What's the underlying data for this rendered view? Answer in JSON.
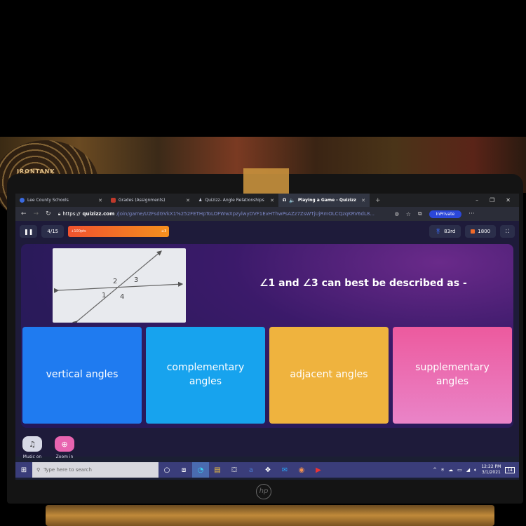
{
  "browser": {
    "tabs": [
      {
        "label": "Lee County Schools",
        "active": false,
        "favicon_color": "#3a6ae0"
      },
      {
        "label": "Grades (Assignments)",
        "active": false,
        "favicon_color": "#c0392b"
      },
      {
        "label": "Quizizz- Angle Relationships",
        "active": false,
        "favicon_color": "#ffffff"
      },
      {
        "label": "Playing a Game - Quizizz",
        "active": true,
        "favicon_color": "#ffffff"
      }
    ],
    "new_tab": "+",
    "window_controls": {
      "minimize": "–",
      "maximize": "❐",
      "close": "✕"
    },
    "url_scheme": "https://",
    "url_domain": "quizizz.com",
    "url_path": "/join/game/U2FsdGVkX1%252FETHpToLOFWwXpzylwyDVF1EvHThwPsAZz7ZsWTjUjRmOLCQzqKRV6dL8...",
    "inprivate_label": "InPrivate",
    "more": "···"
  },
  "quiz": {
    "question_counter": "4/15",
    "streak_label": "+100pts",
    "streak_count": "3",
    "rank": "83rd",
    "score": "1800",
    "figure_labels": [
      "1",
      "2",
      "3",
      "4"
    ],
    "question": "∠1 and ∠3 can best be described as -",
    "answers": [
      {
        "label": "vertical angles",
        "color": "#1f7bf0"
      },
      {
        "label": "complementary angles",
        "color": "#17a3ee"
      },
      {
        "label": "adjacent angles",
        "color": "#efb33e"
      },
      {
        "label": "supplementary angles",
        "color": "#ec5fa8"
      }
    ],
    "tools": [
      {
        "label": "Music on",
        "icon": "music-note-icon",
        "color": "#d7d9e6"
      },
      {
        "label": "Zoom in",
        "icon": "zoom-in-icon",
        "color": "#e864b0"
      }
    ]
  },
  "taskbar": {
    "search_placeholder": "Type here to search",
    "time": "12:22 PM",
    "date": "3/1/2021",
    "notification_count": "14"
  },
  "device": {
    "brand": "hp",
    "fan_brand": "IRONTANK"
  }
}
